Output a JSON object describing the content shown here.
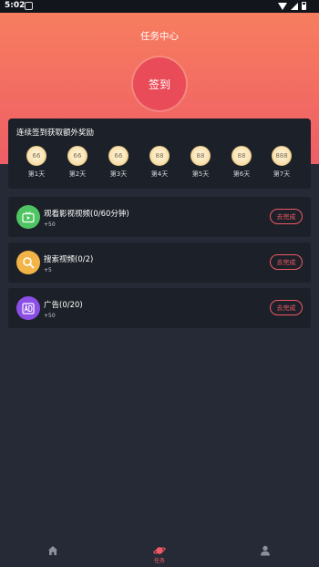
{
  "status_bar": {
    "time": "5:02"
  },
  "header": {
    "title": "任务中心",
    "checkin_label": "签到"
  },
  "streak": {
    "title": "连续签到获取额外奖励",
    "days": [
      {
        "amount": "66",
        "label": "第1天"
      },
      {
        "amount": "66",
        "label": "第2天"
      },
      {
        "amount": "66",
        "label": "第3天"
      },
      {
        "amount": "88",
        "label": "第4天"
      },
      {
        "amount": "88",
        "label": "第5天"
      },
      {
        "amount": "88",
        "label": "第6天"
      },
      {
        "amount": "888",
        "label": "第7天"
      }
    ]
  },
  "tasks": [
    {
      "name": "观看影视视频(0/60分钟)",
      "reward": "+50",
      "button": "去完成",
      "icon": "video-icon",
      "color": "#4fc462"
    },
    {
      "name": "搜索视频(0/2)",
      "reward": "+5",
      "button": "去完成",
      "icon": "search-icon",
      "color": "#f3b447"
    },
    {
      "name": "广告(0/20)",
      "reward": "+50",
      "button": "去完成",
      "icon": "ad-icon",
      "color": "#8b4fe6"
    }
  ],
  "tabbar": {
    "items": [
      {
        "label": "",
        "icon": "home-icon",
        "active": false
      },
      {
        "label": "任务",
        "icon": "planet-icon",
        "active": true
      },
      {
        "label": "",
        "icon": "user-icon",
        "active": false
      }
    ],
    "active_color": "#ee5a66"
  }
}
